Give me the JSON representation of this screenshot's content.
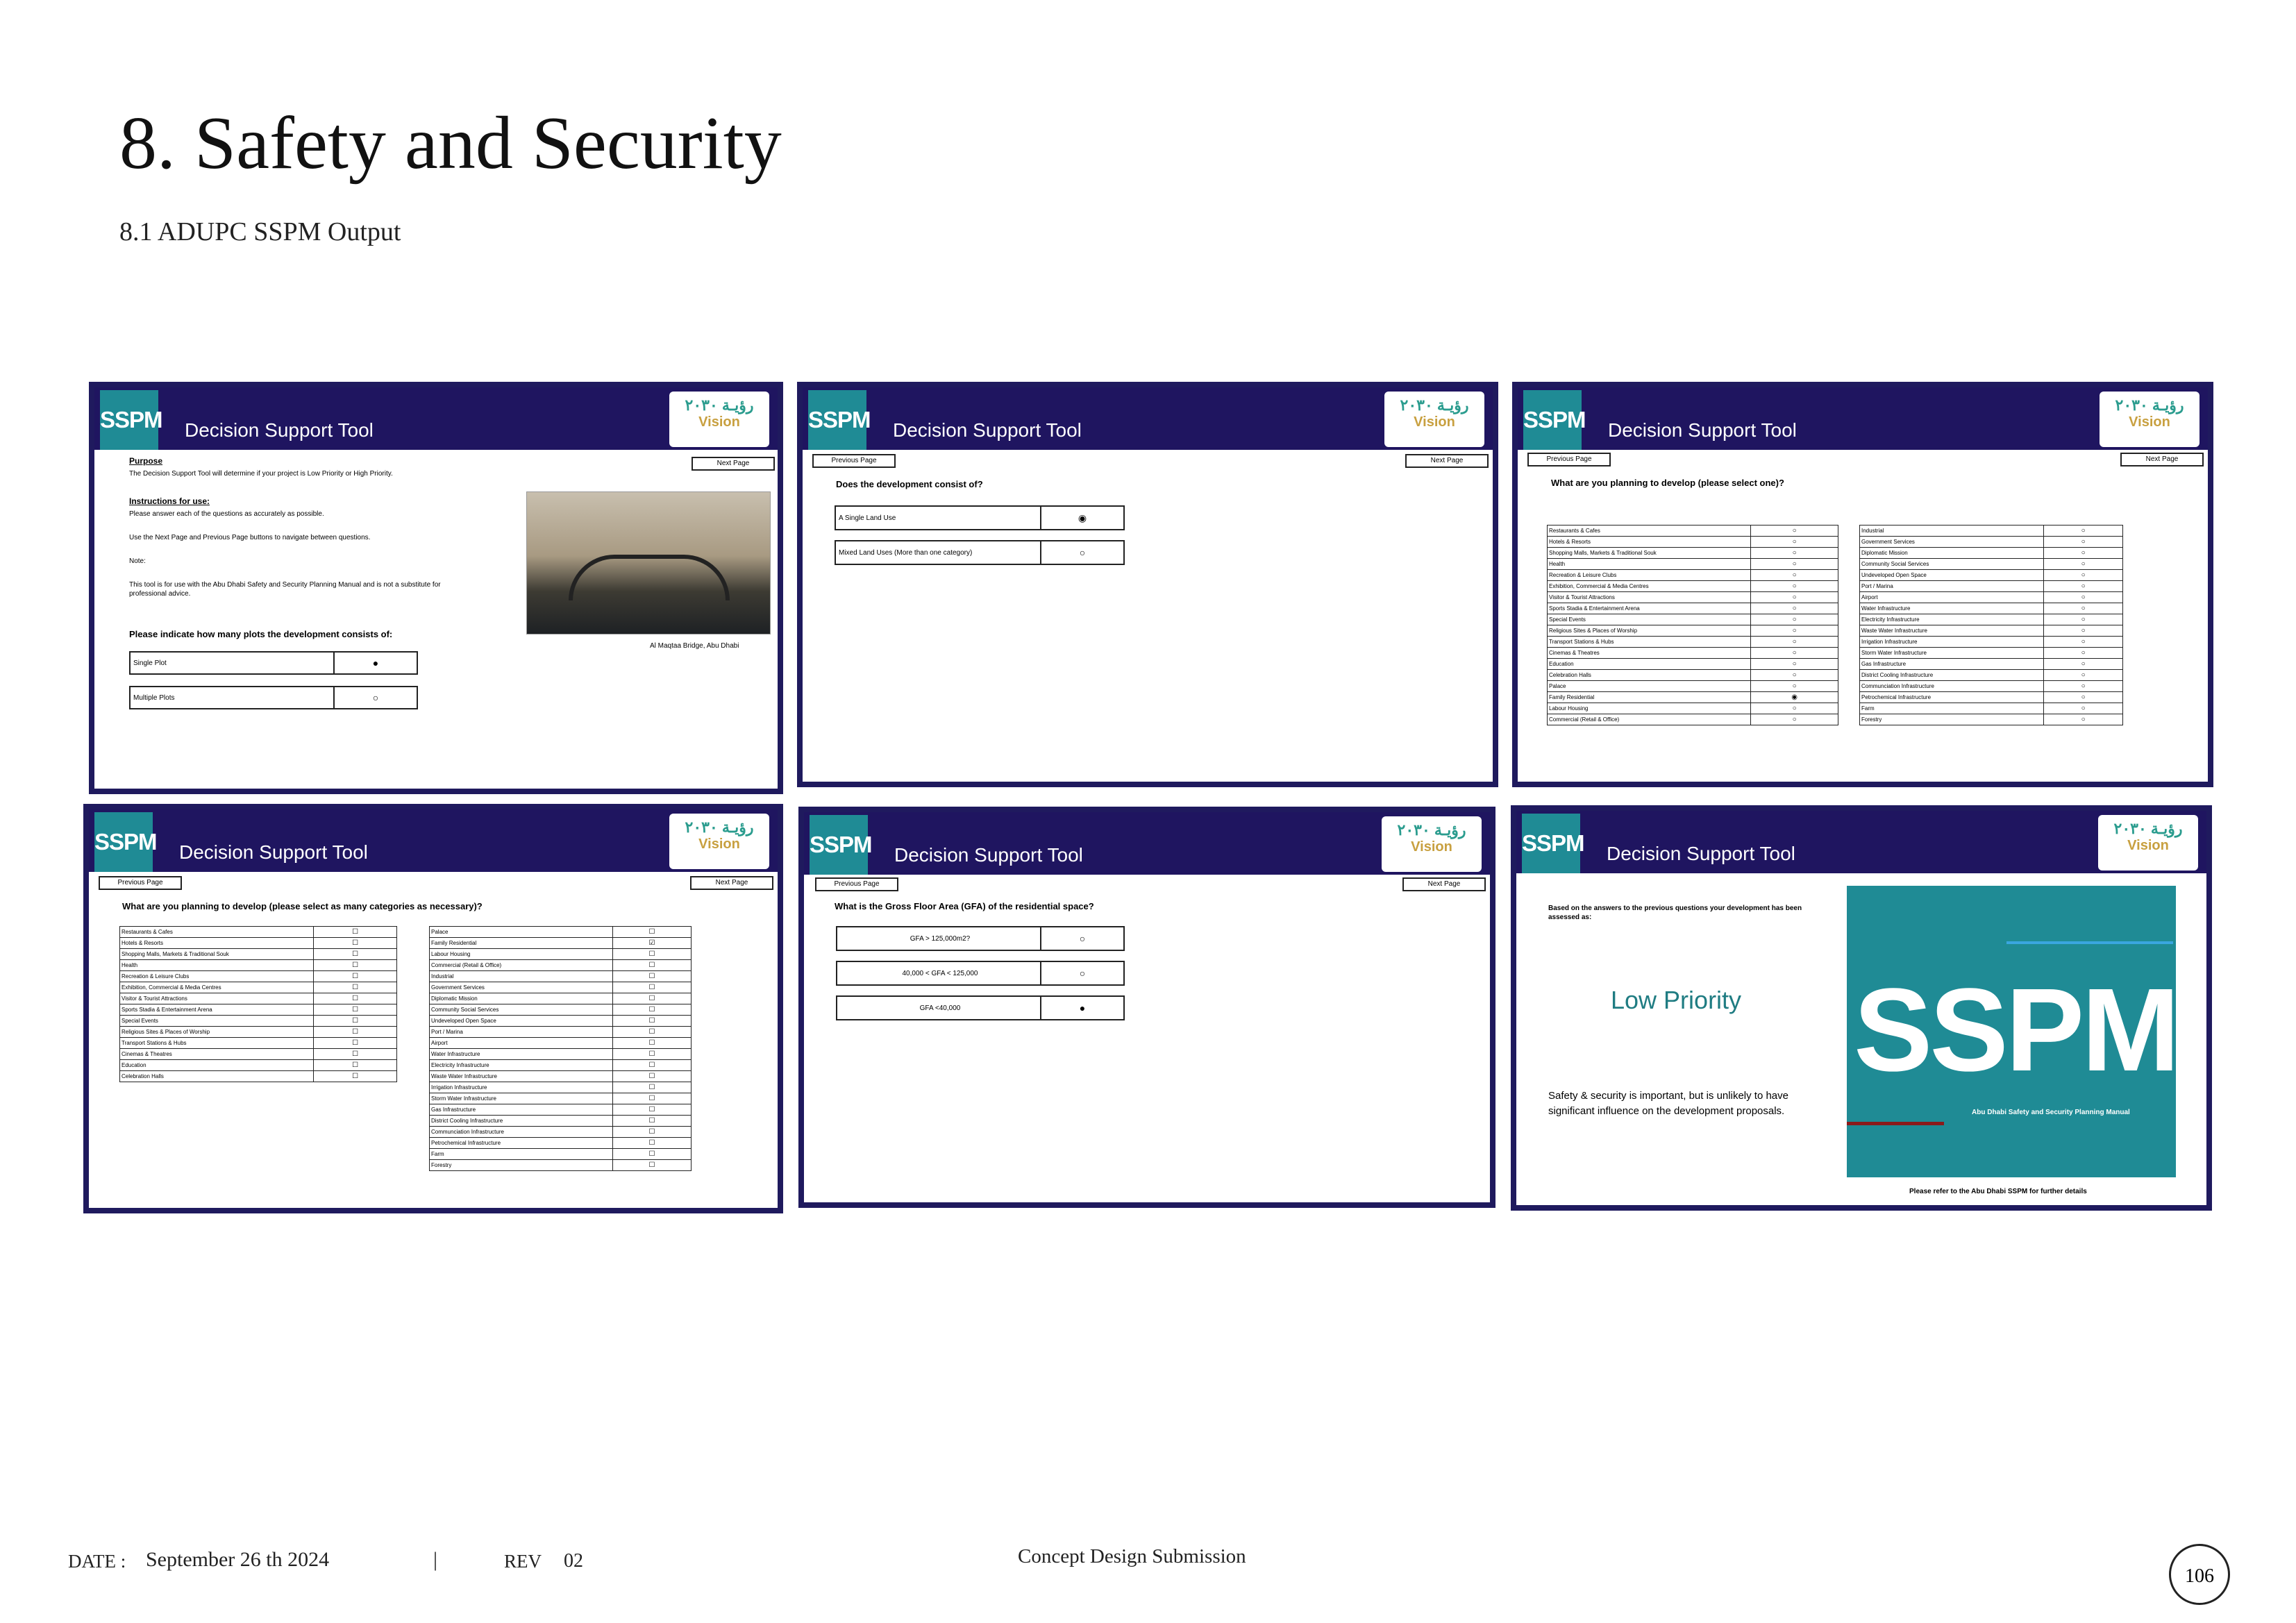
{
  "page": {
    "title": "8. Safety and Security",
    "subtitle": "8.1 ADUPC SSPM Output"
  },
  "common": {
    "sspm": "SSPM",
    "tool_title": "Decision Support Tool",
    "logo_text": "رؤيـة ٢٠٣٠",
    "logo_vision": "Vision",
    "next": "Next Page",
    "prev": "Previous Page"
  },
  "panel1": {
    "purpose_h": "Purpose",
    "purpose_t": "The Decision Support Tool will determine if your project is Low Priority or High Priority.",
    "instr_h": "Instructions for use:",
    "instr_t": "Please answer each of the questions as accurately as possible.",
    "nav_t": "Use the Next Page and Previous Page buttons to navigate between questions.",
    "note_h": "Note:",
    "note_t": "This tool is for use with the Abu Dhabi Safety and Security Planning Manual and is not a substitute for professional advice.",
    "question": "Please indicate how many plots the development consists of:",
    "caption": "Al Maqtaa Bridge, Abu Dhabi",
    "options": [
      {
        "label": "Single Plot",
        "mark": "●"
      },
      {
        "label": "Multiple Plots",
        "mark": "○"
      }
    ]
  },
  "panel2": {
    "question": "Does the development consist of?",
    "options": [
      {
        "label": "A Single Land Use",
        "mark": "◉"
      },
      {
        "label": "Mixed Land Uses (More than one category)",
        "mark": "○"
      }
    ]
  },
  "panel3": {
    "question": "What are you planning to develop (please select one)?",
    "left": [
      "Restaurants & Cafes",
      "Hotels & Resorts",
      "Shopping Malls, Markets & Traditional Souk",
      "Health",
      "Recreation & Leisure Clubs",
      "Exhibition, Commercial & Media Centres",
      "Visitor & Tourist Attractions",
      "Sports Stadia & Entertainment Arena",
      "Special Events",
      "Religious Sites & Places of Worship",
      "Transport Stations & Hubs",
      "Cinemas & Theatres",
      "Education",
      "Celebration Halls",
      "Palace",
      "Family Residential",
      "Labour Housing",
      "Commercial (Retail & Office)"
    ],
    "left_marks": [
      "○",
      "○",
      "○",
      "○",
      "○",
      "○",
      "○",
      "○",
      "○",
      "○",
      "○",
      "○",
      "○",
      "○",
      "○",
      "◉",
      "○",
      "○"
    ],
    "right": [
      "Industrial",
      "Government Services",
      "Diplomatic Mission",
      "Community Social Services",
      "Undeveloped Open Space",
      "Port / Marina",
      "Airport",
      "Water Infrastructure",
      "Electricity Infrastructure",
      "Waste Water Infrastructure",
      "Irrigation Infrastructure",
      "Storm Water Infrastructure",
      "Gas Infrastructure",
      "District Cooling Infrastructure",
      "Communciation Infrastructure",
      "Petrochemical Infrastructure",
      "Farm",
      "Forestry"
    ],
    "right_marks": [
      "○",
      "○",
      "○",
      "○",
      "○",
      "○",
      "○",
      "○",
      "○",
      "○",
      "○",
      "○",
      "○",
      "○",
      "○",
      "○",
      "○",
      "○"
    ]
  },
  "panel4": {
    "question": "What are you planning to develop (please select as many categories as necessary)?",
    "left": [
      "Restaurants & Cafes",
      "Hotels & Resorts",
      "Shopping Malls, Markets & Traditional Souk",
      "Health",
      "Recreation & Leisure Clubs",
      "Exhibition, Commercial & Media Centres",
      "Visitor & Tourist Attractions",
      "Sports Stadia & Entertainment Arena",
      "Special Events",
      "Religious Sites & Places of Worship",
      "Transport Stations & Hubs",
      "Cinemas & Theatres",
      "Education",
      "Celebration Halls"
    ],
    "left_marks": [
      "☐",
      "☐",
      "☐",
      "☐",
      "☐",
      "☐",
      "☐",
      "☐",
      "☐",
      "☐",
      "☐",
      "☐",
      "☐",
      "☐"
    ],
    "right": [
      "Palace",
      "Family Residential",
      "Labour Housing",
      "Commercial (Retail & Office)",
      "Industrial",
      "Government Services",
      "Diplomatic Mission",
      "Community Social Services",
      "Undeveloped Open Space",
      "Port / Marina",
      "Airport",
      "Water Infrastructure",
      "Electricity Infrastructure",
      "Waste Water Infrastructure",
      "Irrigation Infrastructure",
      "Storm Water Infrastructure",
      "Gas Infrastructure",
      "District Cooling Infrastructure",
      "Communciation Infrastructure",
      "Petrochemical Infrastructure",
      "Farm",
      "Forestry"
    ],
    "right_marks": [
      "☐",
      "☑",
      "☐",
      "☐",
      "☐",
      "☐",
      "☐",
      "☐",
      "☐",
      "☐",
      "☐",
      "☐",
      "☐",
      "☐",
      "☐",
      "☐",
      "☐",
      "☐",
      "☐",
      "☐",
      "☐",
      "☐"
    ]
  },
  "panel5": {
    "question": "What is the Gross Floor Area (GFA) of the residential space?",
    "options": [
      {
        "label": "GFA > 125,000m2?",
        "mark": "○"
      },
      {
        "label": "40,000 < GFA < 125,000",
        "mark": "○"
      },
      {
        "label": "GFA <40,000",
        "mark": "●"
      }
    ]
  },
  "panel6": {
    "intro": "Based on the answers to the previous questions your development has been assessed as:",
    "result": "Low Priority",
    "desc": "Safety & security is important, but is unlikely to have significant influence on the development proposals.",
    "cover_big": "SSPM",
    "cover_sub": "Abu Dhabi Safety and Security Planning Manual",
    "refer": "Please refer to the Abu Dhabi SSPM for further details"
  },
  "footer": {
    "date_label": "DATE :",
    "date": "September 26 th 2024",
    "sep": "|",
    "rev_label": "REV",
    "rev": "02",
    "center": "Concept Design Submission",
    "page_number": "106"
  },
  "colors": {
    "header": "#1f1560",
    "teal": "#1f8b95",
    "border": "#1f1a5e"
  }
}
